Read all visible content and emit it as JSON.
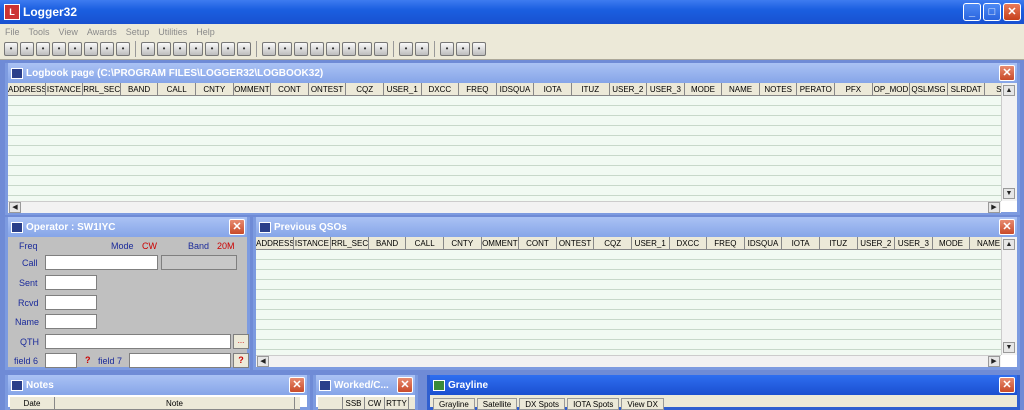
{
  "app": {
    "title": "Logger32"
  },
  "menu": [
    "File",
    "Tools",
    "View",
    "Awards",
    "Setup",
    "Utilities",
    "Help"
  ],
  "toolbar_icons": [
    "logbook",
    "print",
    "find",
    "edit",
    "clear",
    "bandmap",
    "dx",
    "settings",
    "cluster",
    "globe",
    "table",
    "tools",
    "layout",
    "band",
    "radio",
    "terminal",
    "window1",
    "window2",
    "fn",
    "number",
    "tune",
    "color",
    "cw",
    "rtty",
    "telnet",
    "power",
    "settings2",
    "sound"
  ],
  "logbook": {
    "title": "Logbook page (C:\\PROGRAM FILES\\LOGGER32\\LOGBOOK32)",
    "columns": [
      "ADDRESS",
      "ISTANCE",
      "RRL_SEC",
      "BAND",
      "CALL",
      "CNTY",
      "OMMENT",
      "CONT",
      "ONTEST",
      "CQZ",
      "USER_1",
      "DXCC",
      "FREQ",
      "IDSQUA",
      "IOTA",
      "ITUZ",
      "USER_2",
      "USER_3",
      "MODE",
      "NAME",
      "NOTES",
      "PERATO",
      "PFX",
      "OP_MOD",
      "QSLMSG",
      "SLRDAT",
      "SLS"
    ]
  },
  "operator": {
    "title": "Operator : SW1IYC",
    "freq_label": "Freq",
    "mode_label": "Mode",
    "mode_value": "CW",
    "band_label": "Band",
    "band_value": "20M",
    "labels": {
      "call": "Call",
      "sent": "Sent",
      "rcvd": "Rcvd",
      "name": "Name",
      "qth": "QTH",
      "field6": "field 6",
      "field7": "field 7"
    },
    "qth_btn": "...",
    "help_btn": "?"
  },
  "prev": {
    "title": "Previous QSOs",
    "columns": [
      "ADDRESS",
      "ISTANCE",
      "RRL_SEC",
      "BAND",
      "CALL",
      "CNTY",
      "OMMENT",
      "CONT",
      "ONTEST",
      "CQZ",
      "USER_1",
      "DXCC",
      "FREQ",
      "IDSQUA",
      "IOTA",
      "ITUZ",
      "USER_2",
      "USER_3",
      "MODE",
      "NAME"
    ]
  },
  "notes": {
    "title": "Notes",
    "col_date": "Date",
    "col_note": "Note"
  },
  "worked": {
    "title": "Worked/C...",
    "cols": [
      "",
      "SSB",
      "CW",
      "RTTY"
    ]
  },
  "grayline": {
    "title": "Grayline",
    "tabs": [
      "Grayline",
      "Satellite",
      "DX Spots",
      "IOTA Spots",
      "View DX"
    ]
  },
  "colors": {
    "accent": "#316ac5",
    "mode": "#cc0000",
    "label": "#1a2a9a"
  }
}
